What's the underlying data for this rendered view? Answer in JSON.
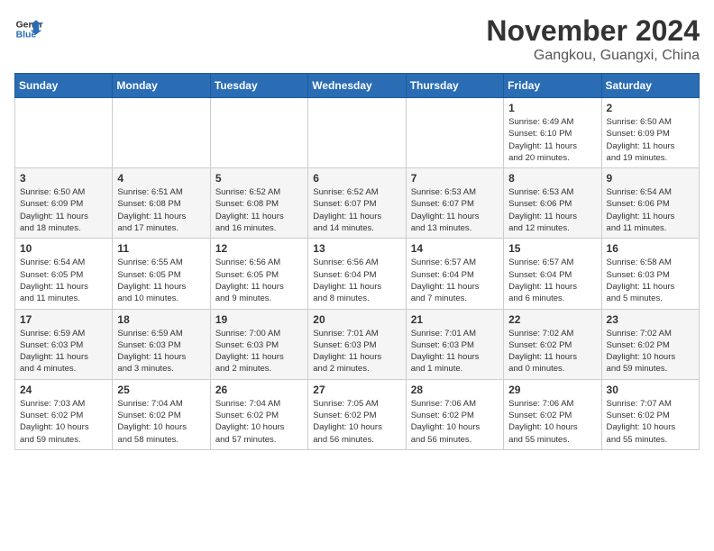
{
  "header": {
    "logo_line1": "General",
    "logo_line2": "Blue",
    "month_year": "November 2024",
    "location": "Gangkou, Guangxi, China"
  },
  "weekdays": [
    "Sunday",
    "Monday",
    "Tuesday",
    "Wednesday",
    "Thursday",
    "Friday",
    "Saturday"
  ],
  "weeks": [
    [
      {
        "day": "",
        "detail": ""
      },
      {
        "day": "",
        "detail": ""
      },
      {
        "day": "",
        "detail": ""
      },
      {
        "day": "",
        "detail": ""
      },
      {
        "day": "",
        "detail": ""
      },
      {
        "day": "1",
        "detail": "Sunrise: 6:49 AM\nSunset: 6:10 PM\nDaylight: 11 hours\nand 20 minutes."
      },
      {
        "day": "2",
        "detail": "Sunrise: 6:50 AM\nSunset: 6:09 PM\nDaylight: 11 hours\nand 19 minutes."
      }
    ],
    [
      {
        "day": "3",
        "detail": "Sunrise: 6:50 AM\nSunset: 6:09 PM\nDaylight: 11 hours\nand 18 minutes."
      },
      {
        "day": "4",
        "detail": "Sunrise: 6:51 AM\nSunset: 6:08 PM\nDaylight: 11 hours\nand 17 minutes."
      },
      {
        "day": "5",
        "detail": "Sunrise: 6:52 AM\nSunset: 6:08 PM\nDaylight: 11 hours\nand 16 minutes."
      },
      {
        "day": "6",
        "detail": "Sunrise: 6:52 AM\nSunset: 6:07 PM\nDaylight: 11 hours\nand 14 minutes."
      },
      {
        "day": "7",
        "detail": "Sunrise: 6:53 AM\nSunset: 6:07 PM\nDaylight: 11 hours\nand 13 minutes."
      },
      {
        "day": "8",
        "detail": "Sunrise: 6:53 AM\nSunset: 6:06 PM\nDaylight: 11 hours\nand 12 minutes."
      },
      {
        "day": "9",
        "detail": "Sunrise: 6:54 AM\nSunset: 6:06 PM\nDaylight: 11 hours\nand 11 minutes."
      }
    ],
    [
      {
        "day": "10",
        "detail": "Sunrise: 6:54 AM\nSunset: 6:05 PM\nDaylight: 11 hours\nand 11 minutes."
      },
      {
        "day": "11",
        "detail": "Sunrise: 6:55 AM\nSunset: 6:05 PM\nDaylight: 11 hours\nand 10 minutes."
      },
      {
        "day": "12",
        "detail": "Sunrise: 6:56 AM\nSunset: 6:05 PM\nDaylight: 11 hours\nand 9 minutes."
      },
      {
        "day": "13",
        "detail": "Sunrise: 6:56 AM\nSunset: 6:04 PM\nDaylight: 11 hours\nand 8 minutes."
      },
      {
        "day": "14",
        "detail": "Sunrise: 6:57 AM\nSunset: 6:04 PM\nDaylight: 11 hours\nand 7 minutes."
      },
      {
        "day": "15",
        "detail": "Sunrise: 6:57 AM\nSunset: 6:04 PM\nDaylight: 11 hours\nand 6 minutes."
      },
      {
        "day": "16",
        "detail": "Sunrise: 6:58 AM\nSunset: 6:03 PM\nDaylight: 11 hours\nand 5 minutes."
      }
    ],
    [
      {
        "day": "17",
        "detail": "Sunrise: 6:59 AM\nSunset: 6:03 PM\nDaylight: 11 hours\nand 4 minutes."
      },
      {
        "day": "18",
        "detail": "Sunrise: 6:59 AM\nSunset: 6:03 PM\nDaylight: 11 hours\nand 3 minutes."
      },
      {
        "day": "19",
        "detail": "Sunrise: 7:00 AM\nSunset: 6:03 PM\nDaylight: 11 hours\nand 2 minutes."
      },
      {
        "day": "20",
        "detail": "Sunrise: 7:01 AM\nSunset: 6:03 PM\nDaylight: 11 hours\nand 2 minutes."
      },
      {
        "day": "21",
        "detail": "Sunrise: 7:01 AM\nSunset: 6:03 PM\nDaylight: 11 hours\nand 1 minute."
      },
      {
        "day": "22",
        "detail": "Sunrise: 7:02 AM\nSunset: 6:02 PM\nDaylight: 11 hours\nand 0 minutes."
      },
      {
        "day": "23",
        "detail": "Sunrise: 7:02 AM\nSunset: 6:02 PM\nDaylight: 10 hours\nand 59 minutes."
      }
    ],
    [
      {
        "day": "24",
        "detail": "Sunrise: 7:03 AM\nSunset: 6:02 PM\nDaylight: 10 hours\nand 59 minutes."
      },
      {
        "day": "25",
        "detail": "Sunrise: 7:04 AM\nSunset: 6:02 PM\nDaylight: 10 hours\nand 58 minutes."
      },
      {
        "day": "26",
        "detail": "Sunrise: 7:04 AM\nSunset: 6:02 PM\nDaylight: 10 hours\nand 57 minutes."
      },
      {
        "day": "27",
        "detail": "Sunrise: 7:05 AM\nSunset: 6:02 PM\nDaylight: 10 hours\nand 56 minutes."
      },
      {
        "day": "28",
        "detail": "Sunrise: 7:06 AM\nSunset: 6:02 PM\nDaylight: 10 hours\nand 56 minutes."
      },
      {
        "day": "29",
        "detail": "Sunrise: 7:06 AM\nSunset: 6:02 PM\nDaylight: 10 hours\nand 55 minutes."
      },
      {
        "day": "30",
        "detail": "Sunrise: 7:07 AM\nSunset: 6:02 PM\nDaylight: 10 hours\nand 55 minutes."
      }
    ]
  ]
}
